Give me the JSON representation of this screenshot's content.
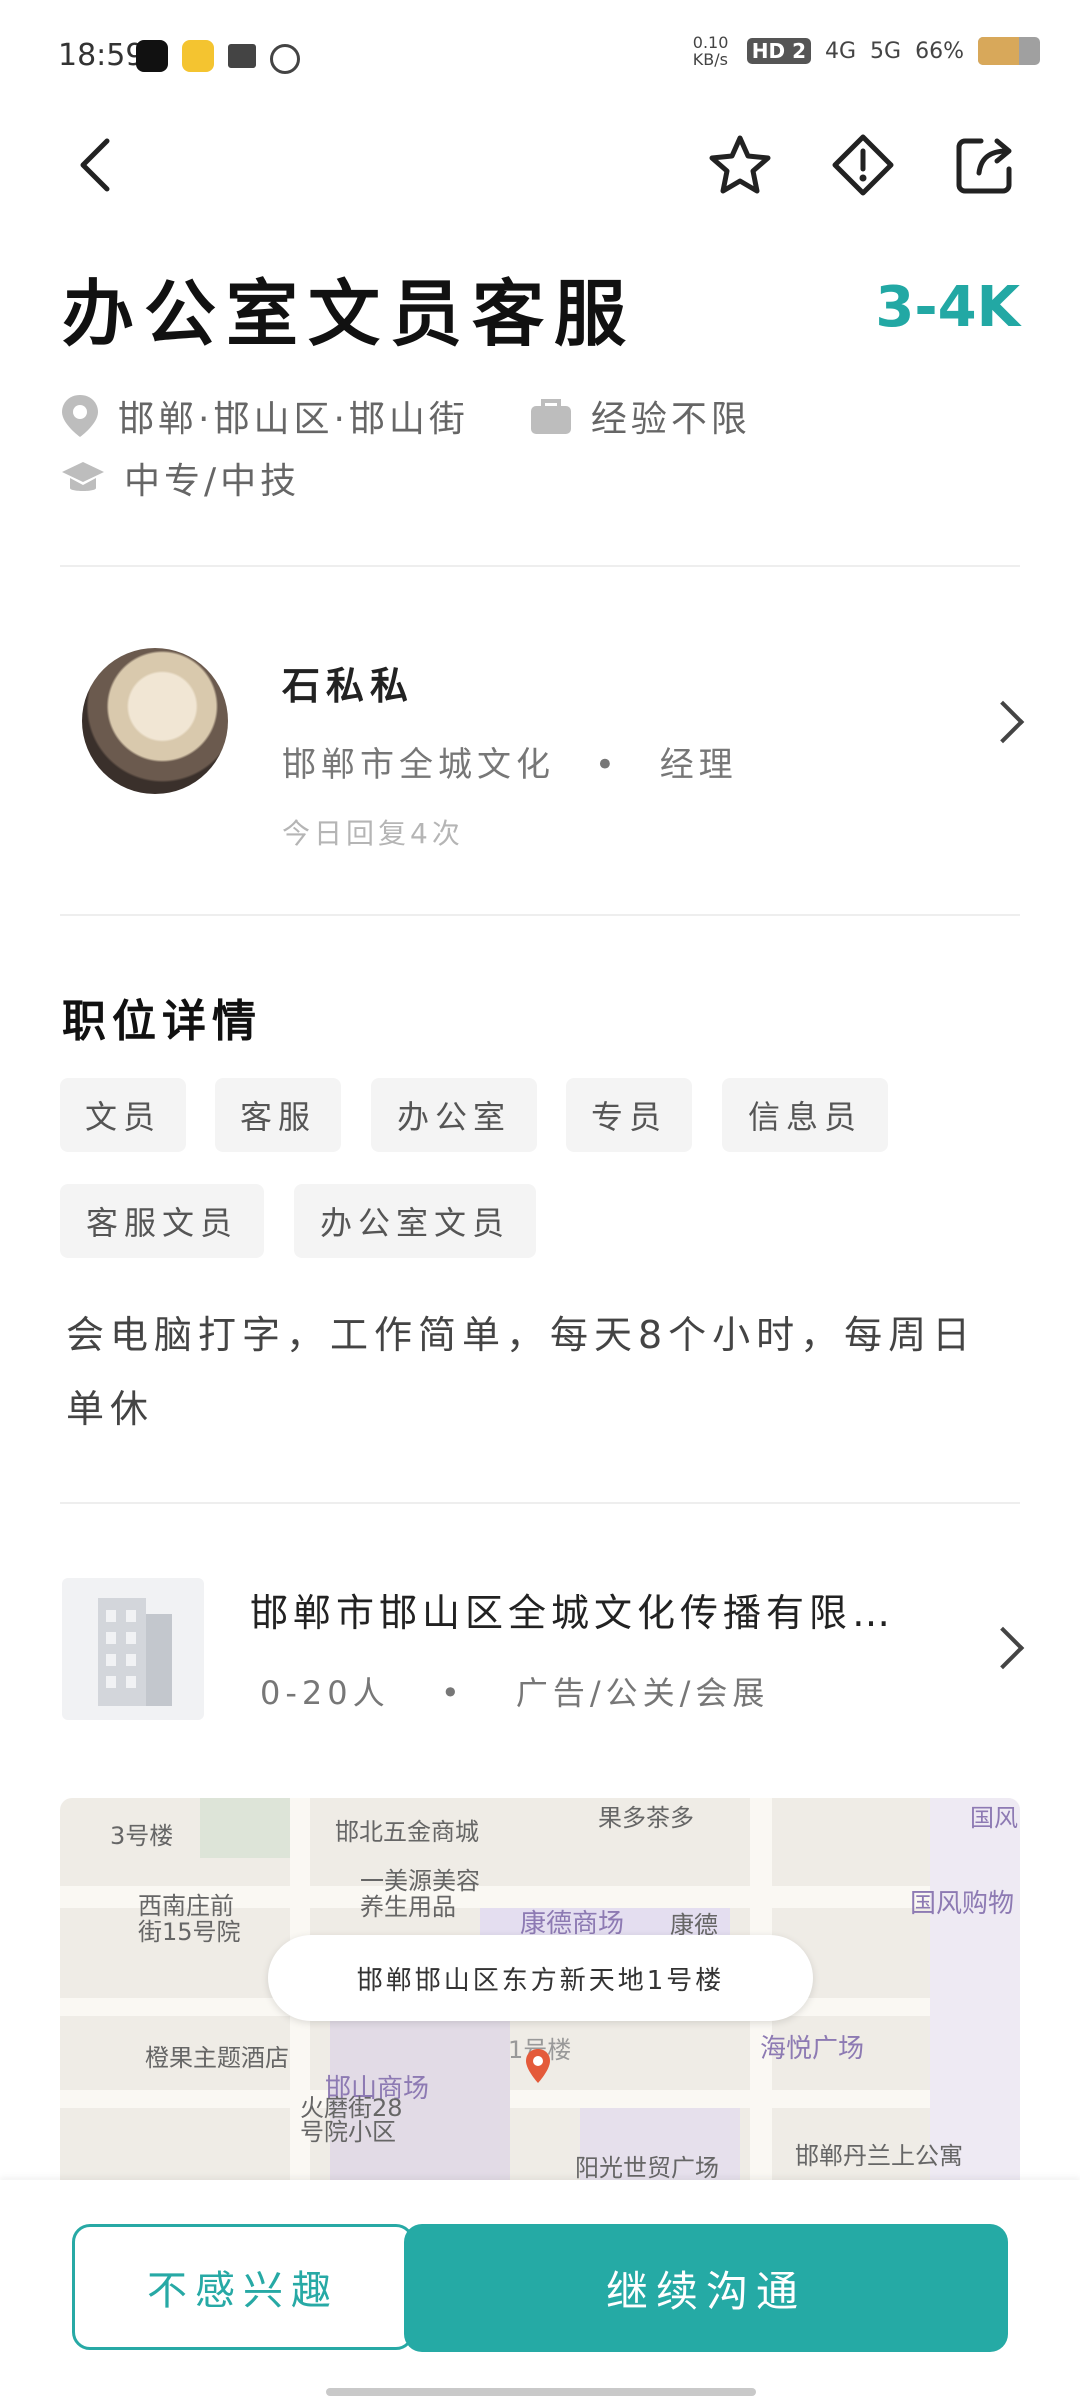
{
  "status_bar": {
    "time": "18:59",
    "speed": "0.10 KB/s",
    "signals": [
      "HD 2",
      "4G",
      "5G"
    ],
    "battery": "66%",
    "battery_level": 0.66
  },
  "job": {
    "title": "办公室文员客服",
    "salary": "3-4K",
    "location": "邯郸·邯山区·邯山街",
    "experience": "经验不限",
    "education": "中专/中技"
  },
  "recruiter": {
    "name": "石私私",
    "company": "邯郸市全城文化",
    "separator": "•",
    "role": "经理",
    "reply_count": "今日回复4次"
  },
  "details": {
    "section_title": "职位详情",
    "tags": [
      "文员",
      "客服",
      "办公室",
      "专员",
      "信息员",
      "客服文员",
      "办公室文员"
    ],
    "description": "会电脑打字，工作简单，每天8个小时，每周日单休"
  },
  "company": {
    "name": "邯郸市邯山区全城文化传播有限…",
    "size": "0-20人",
    "separator": "•",
    "industry": "广告/公关/会展"
  },
  "map": {
    "address": "邯郸邯山区东方新天地1号楼",
    "labels": [
      "3号楼",
      "邯北五金商城",
      "果多茶多",
      "国风",
      "西南庄前街15号院",
      "一美源美容养生用品",
      "康德商场",
      "康德",
      "国风购物",
      "橙果主题酒店",
      "1号楼",
      "海悦广场",
      "邯山商场",
      "火磨街28号院小区",
      "阳光世贸广场",
      "邯郸丹兰上公寓"
    ]
  },
  "actions": {
    "not_interested": "不感兴趣",
    "continue_chat": "继续沟通"
  },
  "colors": {
    "accent": "#25aaa5"
  }
}
